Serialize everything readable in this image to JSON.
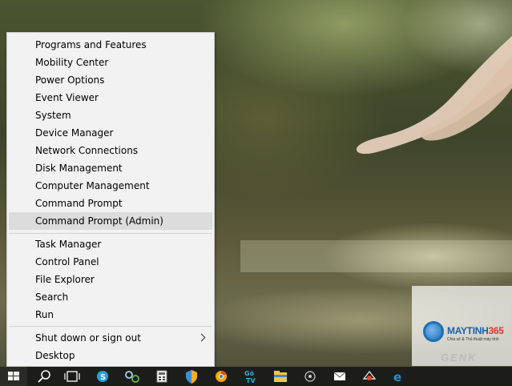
{
  "context_menu": {
    "items": [
      {
        "label": "Programs and Features"
      },
      {
        "label": "Mobility Center"
      },
      {
        "label": "Power Options"
      },
      {
        "label": "Event Viewer"
      },
      {
        "label": "System"
      },
      {
        "label": "Device Manager"
      },
      {
        "label": "Network Connections"
      },
      {
        "label": "Disk Management"
      },
      {
        "label": "Computer Management"
      },
      {
        "label": "Command Prompt"
      },
      {
        "label": "Command Prompt (Admin)",
        "highlighted": true
      },
      {
        "label": "Task Manager"
      },
      {
        "label": "Control Panel"
      },
      {
        "label": "File Explorer"
      },
      {
        "label": "Search"
      },
      {
        "label": "Run"
      },
      {
        "label": "Shut down or sign out",
        "has_submenu": true
      },
      {
        "label": "Desktop"
      }
    ]
  },
  "taskbar": {
    "icons": [
      {
        "name": "start-windows-icon"
      },
      {
        "name": "search-icon"
      },
      {
        "name": "task-view-icon"
      },
      {
        "name": "skype-icon"
      },
      {
        "name": "network-apps-icon"
      },
      {
        "name": "calculator-icon"
      },
      {
        "name": "shield-app-icon"
      },
      {
        "name": "chrome-canary-icon"
      },
      {
        "name": "go-tv-icon"
      },
      {
        "name": "file-explorer-icon"
      },
      {
        "name": "media-app-icon"
      },
      {
        "name": "mail-icon"
      },
      {
        "name": "fax-printer-icon"
      },
      {
        "name": "edge-browser-icon"
      }
    ],
    "gotv_text": "Gõ TV"
  },
  "watermark": {
    "brand_a": "MAYTINH",
    "brand_b": "365",
    "tagline": "Chia sẻ & Thủ thuật máy tính",
    "corner": "GENK"
  },
  "colors": {
    "menu_bg": "#f2f2f2",
    "menu_highlight": "#dcdcdc",
    "taskbar_bg": "#1c1d1a",
    "accent_blue": "#1f6fb8"
  }
}
